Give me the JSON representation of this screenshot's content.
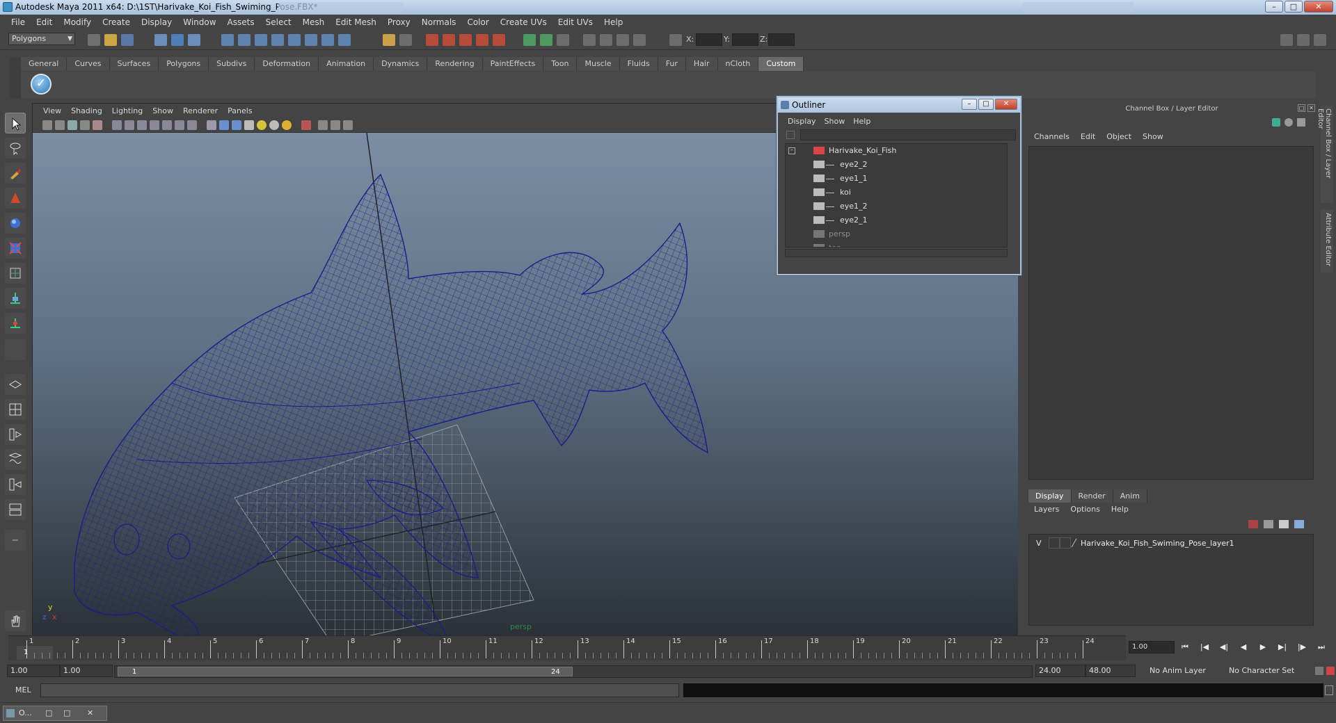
{
  "window": {
    "title": "Autodesk Maya 2011 x64: D:\\1ST\\Harivake_Koi_Fish_Swiming_Pose.FBX*",
    "minimize": "–",
    "maximize": "□",
    "close": "✕"
  },
  "menubar": [
    "File",
    "Edit",
    "Modify",
    "Create",
    "Display",
    "Window",
    "Assets",
    "Select",
    "Mesh",
    "Edit Mesh",
    "Proxy",
    "Normals",
    "Color",
    "Create UVs",
    "Edit UVs",
    "Help"
  ],
  "statusline": {
    "mode": "Polygons",
    "x_label": "X:",
    "y_label": "Y:",
    "z_label": "Z:"
  },
  "shelf": {
    "tabs": [
      "General",
      "Curves",
      "Surfaces",
      "Polygons",
      "Subdivs",
      "Deformation",
      "Animation",
      "Dynamics",
      "Rendering",
      "PaintEffects",
      "Toon",
      "Muscle",
      "Fluids",
      "Fur",
      "Hair",
      "nCloth",
      "Custom"
    ],
    "active_tab": "Custom",
    "check_glyph": "✓"
  },
  "viewport": {
    "menu": [
      "View",
      "Shading",
      "Lighting",
      "Show",
      "Renderer",
      "Panels"
    ],
    "camera_label": "persp",
    "axis": {
      "x": "x",
      "y": "y",
      "z": "z"
    }
  },
  "outliner": {
    "title": "Outliner",
    "menu": [
      "Display",
      "Show",
      "Help"
    ],
    "items": [
      {
        "label": "Harivake_Koi_Fish",
        "depth": 0
      },
      {
        "label": "eye2_2",
        "depth": 1
      },
      {
        "label": "eye1_1",
        "depth": 1
      },
      {
        "label": "koi",
        "depth": 1
      },
      {
        "label": "eye1_2",
        "depth": 1
      },
      {
        "label": "eye2_1",
        "depth": 1
      },
      {
        "label": "persp",
        "depth": 0
      },
      {
        "label": "top",
        "depth": 0
      }
    ]
  },
  "channelbox": {
    "title": "Channel Box / Layer Editor",
    "menu": [
      "Channels",
      "Edit",
      "Object",
      "Show"
    ],
    "layer_tabs": [
      "Display",
      "Render",
      "Anim"
    ],
    "layer_menu": [
      "Layers",
      "Options",
      "Help"
    ],
    "layer": {
      "visible": "V",
      "name": "Harivake_Koi_Fish_Swiming_Pose_layer1"
    }
  },
  "side_tabs": [
    "Channel Box / Layer Editor",
    "Attribute Editor"
  ],
  "timeline": {
    "ticks": [
      1,
      2,
      3,
      4,
      5,
      6,
      7,
      8,
      9,
      10,
      11,
      12,
      13,
      14,
      15,
      16,
      17,
      18,
      19,
      20,
      21,
      22,
      23,
      24
    ],
    "current_frame": "1",
    "current_field": "1.00",
    "playback": [
      "⏮",
      "|◀",
      "◀|",
      "◀",
      "▶",
      "▶|",
      "|▶",
      "⏭"
    ]
  },
  "range": {
    "start_time": "1.00",
    "playback_start": "1.00",
    "range_start_label": "1",
    "range_end_label": "24",
    "playback_end": "24.00",
    "end_time": "48.00",
    "anim_layer": "No Anim Layer",
    "character_set": "No Character Set"
  },
  "cmdline": {
    "label": "MEL"
  },
  "taskbar": {
    "item": "O..."
  },
  "colors": {
    "wireframe": "#1a1d8c",
    "grid": "#9a9a9a",
    "accent": "#a9c2de"
  }
}
